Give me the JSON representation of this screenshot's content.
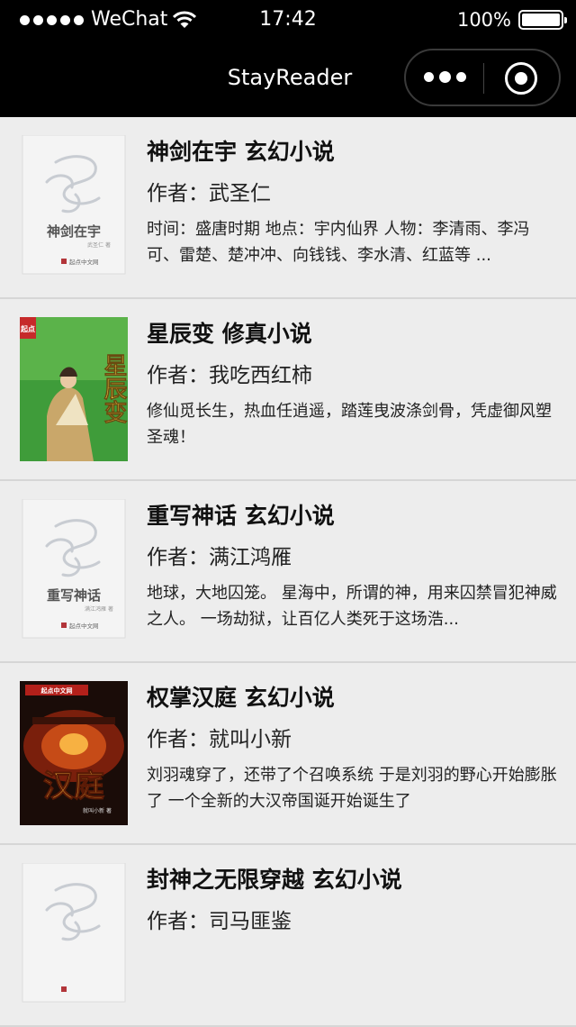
{
  "status_bar": {
    "carrier": "WeChat",
    "time": "17:42",
    "battery": "100%",
    "battery_level": 1.0
  },
  "nav": {
    "title": "StayReader"
  },
  "books": [
    {
      "title": "神剑在宇 玄幻小说",
      "author": "作者：武圣仁",
      "desc": "时间：盛唐时期 地点：宇内仙界 人物：李清雨、李冯可、雷楚、楚冲冲、向钱钱、李水清、红蓝等 ...",
      "cover": {
        "type": "default",
        "name": "神剑在宇",
        "author_line": "武圣仁 著",
        "publisher": "起点中文网"
      }
    },
    {
      "title": "星辰变 修真小说",
      "author": "作者：我吃西红柿",
      "desc": "修仙觅长生，热血任逍遥，踏莲曳波涤剑骨，凭虚御风塑圣魂！",
      "cover": {
        "type": "green",
        "name": "星辰变",
        "badge": "起点"
      }
    },
    {
      "title": "重写神话 玄幻小说",
      "author": "作者：满江鸿雁",
      "desc": "地球，大地囚笼。 星海中，所谓的神，用来囚禁冒犯神威之人。 一场劫狱，让百亿人类死于这场浩...",
      "cover": {
        "type": "default",
        "name": "重写神话",
        "author_line": "满江鸿雁 著",
        "publisher": "起点中文网"
      }
    },
    {
      "title": "权掌汉庭 玄幻小说",
      "author": "作者：就叫小新",
      "desc": "刘羽魂穿了，还带了个召唤系统 于是刘羽的野心开始膨胀了 一个全新的大汉帝国诞开始诞生了",
      "cover": {
        "type": "dark",
        "name": "汉庭",
        "badge": "起点中文网",
        "author_line": "就叫小新 著"
      }
    },
    {
      "title": "封神之无限穿越 玄幻小说",
      "author": "作者：司马匪鉴",
      "desc": "",
      "cover": {
        "type": "default",
        "name": "",
        "author_line": "",
        "publisher": ""
      }
    }
  ]
}
